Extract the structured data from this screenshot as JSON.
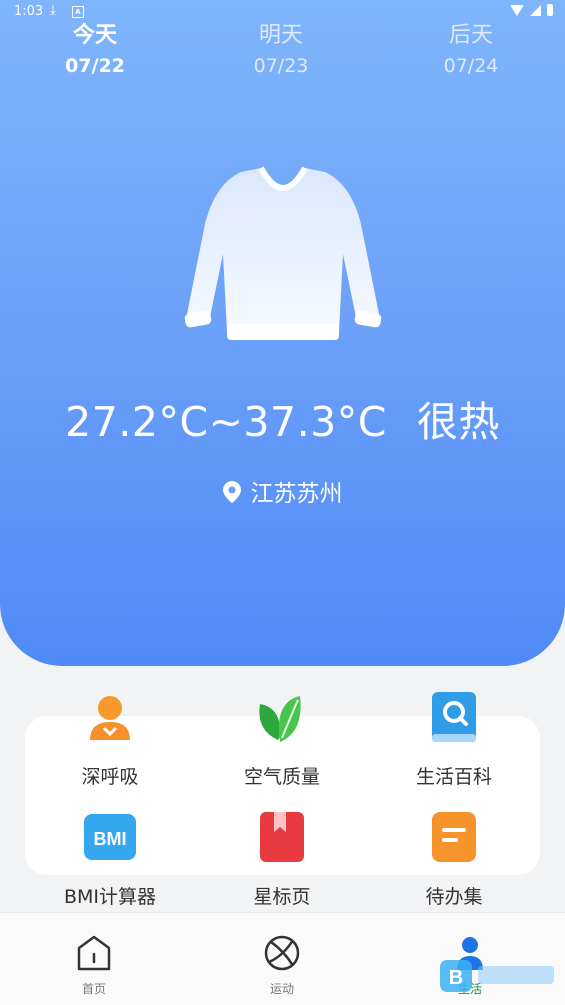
{
  "status_bar": {
    "time": "1:03",
    "a_badge": "A"
  },
  "days": [
    {
      "name": "今天",
      "date": "07/22",
      "active": true
    },
    {
      "name": "明天",
      "date": "07/23",
      "active": false
    },
    {
      "name": "后天",
      "date": "07/24",
      "active": false
    }
  ],
  "weather": {
    "temp_range": "27.2°C~37.3°C",
    "condition": "很热",
    "location": "江苏苏州",
    "clothing_icon": "sweater-icon"
  },
  "features": [
    {
      "label": "深呼吸",
      "icon": "person-icon"
    },
    {
      "label": "空气质量",
      "icon": "leaf-icon"
    },
    {
      "label": "生活百科",
      "icon": "book-search-icon"
    },
    {
      "label": "BMI计算器",
      "icon": "bmi-icon",
      "badge": "BMI"
    },
    {
      "label": "星标页",
      "icon": "bookmark-icon"
    },
    {
      "label": "待办集",
      "icon": "notes-icon"
    }
  ],
  "tabs": [
    {
      "label": "首页",
      "icon": "home-icon"
    },
    {
      "label": "运动",
      "icon": "ball-icon"
    },
    {
      "label": "生活",
      "icon": "profile-icon",
      "active": true
    }
  ],
  "colors": {
    "hero_top": "#7fb5fb",
    "hero_bottom": "#4f8af7",
    "active_tab": "#1e8e4f"
  }
}
